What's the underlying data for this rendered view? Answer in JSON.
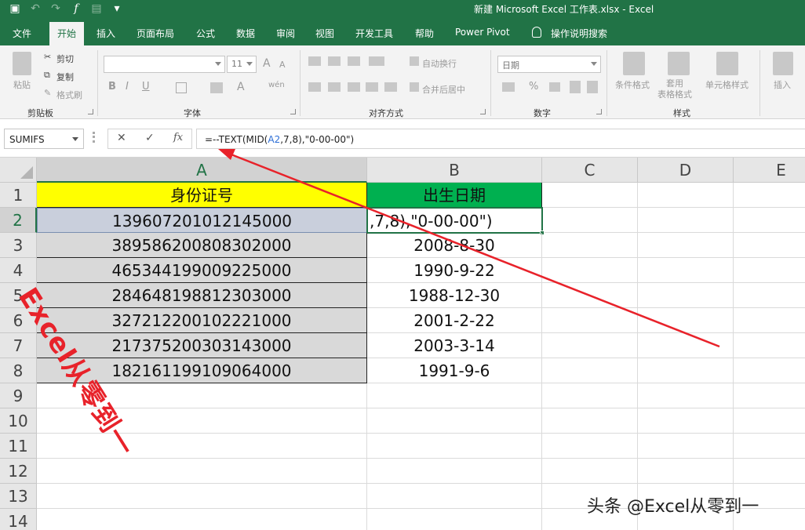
{
  "window": {
    "title": "新建 Microsoft Excel 工作表.xlsx  -  Excel"
  },
  "ribbon_tabs": [
    "文件",
    "开始",
    "插入",
    "页面布局",
    "公式",
    "数据",
    "审阅",
    "视图",
    "开发工具",
    "帮助",
    "Power Pivot",
    "操作说明搜索"
  ],
  "active_tab": "开始",
  "clipboard": {
    "paste": "粘贴",
    "cut": "剪切",
    "copy": "复制",
    "format_painter": "格式刷",
    "group": "剪贴板"
  },
  "font": {
    "name": "",
    "size": "11",
    "bold": "B",
    "italic": "I",
    "underline": "U",
    "grow": "A",
    "shrink": "A",
    "color": "A",
    "wen": "wén",
    "group": "字体"
  },
  "alignment": {
    "wrap": "自动换行",
    "merge": "合并后居中",
    "group": "对齐方式"
  },
  "number": {
    "format": "日期",
    "pct": "%",
    "group": "数字"
  },
  "styles": {
    "conditional": "条件格式",
    "table": "套用\n表格格式",
    "cell": "单元格样式",
    "group": "样式"
  },
  "cells": {
    "insert": "插入"
  },
  "name_box": "SUMIFS",
  "formula": {
    "prefix": "=--TEXT(MID(",
    "ref": "A2",
    "suffix": ",7,8),\"0-00-00\")"
  },
  "columns": [
    "A",
    "B",
    "C",
    "D",
    "E"
  ],
  "rows": [
    "1",
    "2",
    "3",
    "4",
    "5",
    "6",
    "7",
    "8",
    "9",
    "10",
    "11",
    "12",
    "13",
    "14"
  ],
  "sheet": {
    "header_a": "身份证号",
    "header_b": "出生日期",
    "ids": [
      "139607201012145000",
      "389586200808302000",
      "465344199009225000",
      "284648198812303000",
      "327212200102221000",
      "217375200303143000",
      "182161199109064000"
    ],
    "dates": [
      ",7,8),\"0-00-00\")",
      "2008-8-30",
      "1990-9-22",
      "1988-12-30",
      "2001-2-22",
      "2003-3-14",
      "1991-9-6"
    ]
  },
  "watermark": "Excel从零到一",
  "footer_watermark": "头条 @Excel从零到一",
  "colors": {
    "excel_green": "#217346",
    "header_yellow": "#ffff00",
    "header_green": "#00b050",
    "arrow_red": "#e8222a"
  }
}
